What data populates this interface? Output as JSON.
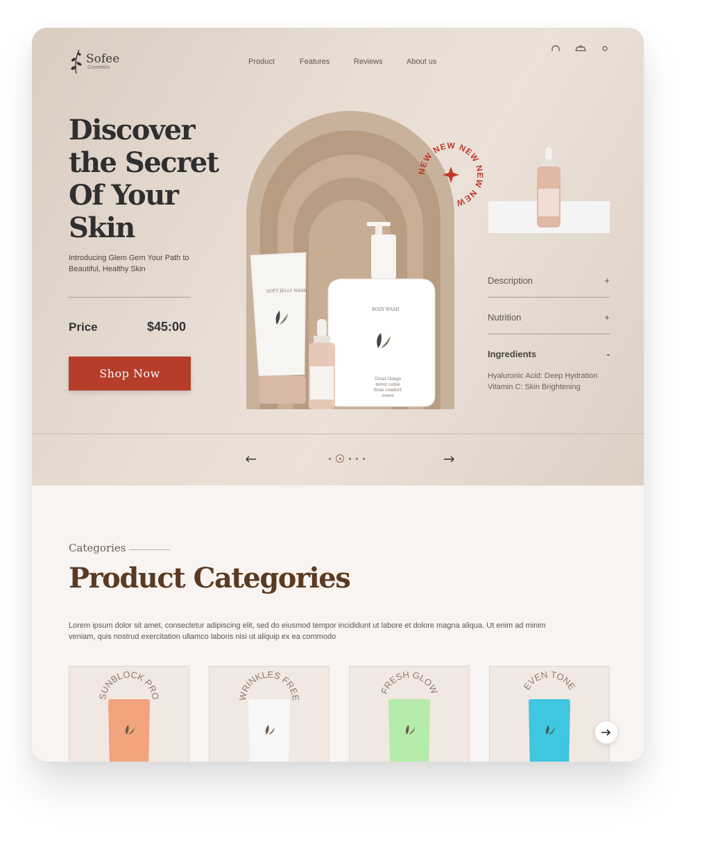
{
  "brand": {
    "name": "Sofee",
    "tagline": "Cosmetics"
  },
  "nav": {
    "items": [
      "Product",
      "Features",
      "Reviews",
      "About us"
    ],
    "icons": [
      "headphones-icon",
      "cart-icon",
      "user-icon"
    ]
  },
  "hero": {
    "title": "Discover the Secret Of Your Skin",
    "subtitle": "Introducing Glem Gem Your Path to Beautiful, Healthy Skin",
    "price_label": "Price",
    "price_value": "$45:00",
    "cta_label": "Shop  Now",
    "badge_text": "NEW NEW NEW NEW NEW ",
    "tube_label": "SOFT JELLY WASH",
    "bottle_label": "BODY WASH",
    "bottle_copy": "Great things never came from comfort zones",
    "accent_color": "#b53d2a"
  },
  "accordion": [
    {
      "label": "Description",
      "toggle": "+"
    },
    {
      "label": "Nutrition",
      "toggle": "+"
    },
    {
      "label": "Ingredients",
      "toggle": "-",
      "details": [
        "Hyaluronic Acid: Deep Hydration",
        "Vitamin C: Skin Brightening"
      ]
    }
  ],
  "carousel": {
    "prev_icon": "arrow-left-icon",
    "next_icon": "arrow-right-icon",
    "slides": 5,
    "active": 2
  },
  "categories": {
    "eyebrow": "Categories",
    "title": "Product Categories",
    "description": "Lorem ipsum dolor sit amet, consectetur adipiscing elit, sed do eiusmod tempor incididunt ut labore et dolore magna aliqua. Ut enim ad minim veniam, quis nostrud exercitation ullamco laboris nisi ut aliquip ex ea commodo",
    "items": [
      {
        "name": "SUNBLOCK PRO",
        "color": "#f2a47c"
      },
      {
        "name": "WRINKLES FREE",
        "color": "#f7f7f7"
      },
      {
        "name": "FRESH GLOW",
        "color": "#b6ecab"
      },
      {
        "name": "EVEN TONE",
        "color": "#3fc6e0"
      }
    ],
    "next_icon": "arrow-right-icon"
  }
}
